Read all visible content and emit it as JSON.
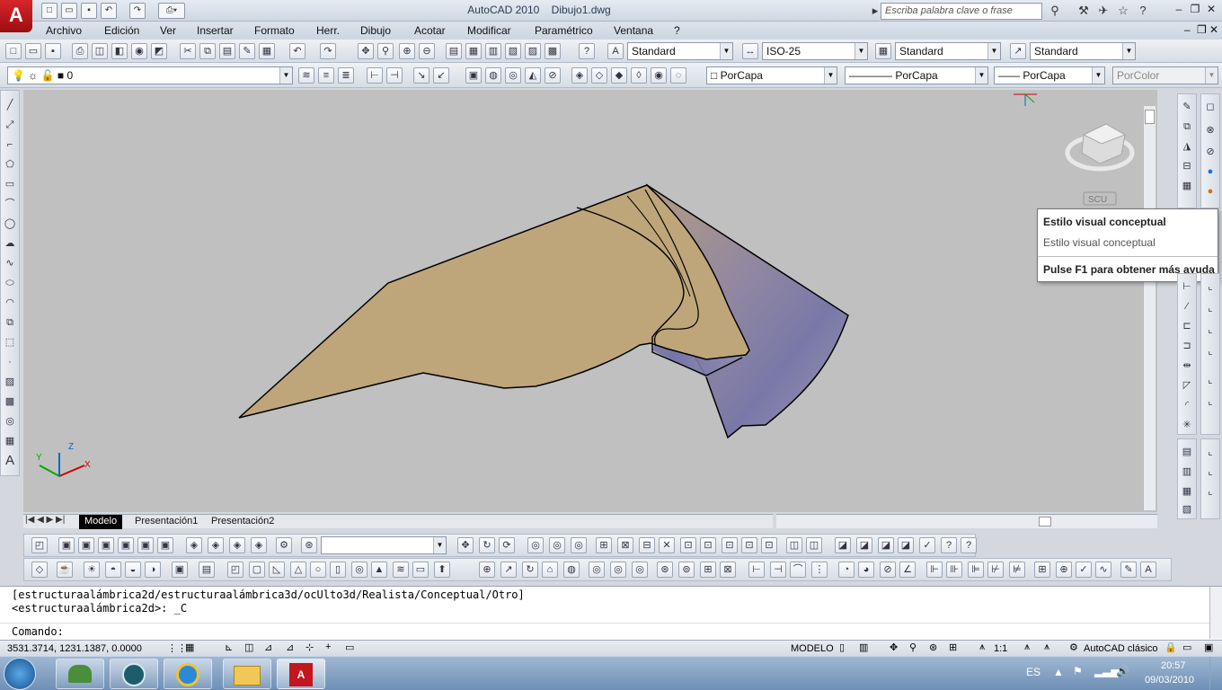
{
  "app": {
    "logo": "A",
    "title": "AutoCAD 2010",
    "document": "Dibujo1.dwg"
  },
  "search": {
    "placeholder": "Escriba palabra clave o frase"
  },
  "menu": [
    "Archivo",
    "Edición",
    "Ver",
    "Insertar",
    "Formato",
    "Herr.",
    "Dibujo",
    "Acotar",
    "Modificar",
    "Paramétrico",
    "Ventana",
    "?"
  ],
  "toolbar1": {
    "text_style": "Standard",
    "dim_style": "ISO-25",
    "table_style": "Standard",
    "mleader_style": "Standard"
  },
  "toolbar2": {
    "layer": "0",
    "color": "PorCapa",
    "linetype": "PorCapa",
    "lineweight": "PorCapa",
    "plotstyle": "PorColor"
  },
  "viewcube": {
    "ucs_label": "SCU"
  },
  "tooltip": {
    "title": "Estilo visual conceptual",
    "description": "Estilo visual conceptual",
    "help": "Pulse F1 para obtener más ayuda"
  },
  "tabs": [
    "Modelo",
    "Presentación1",
    "Presentación2"
  ],
  "ucs_axes": {
    "x": "X",
    "y": "Y",
    "z": "Z"
  },
  "command": {
    "history": [
      "[estructuraalámbrica2d/estructuraalámbrica3d/ocUlto3d/Realista/Conceptual/Otro]",
      "<estructuraalámbrica2d>: _C"
    ],
    "prompt": "Comando:"
  },
  "status": {
    "coords": "3531.3714, 1231.1387, 0.0000",
    "space": "MODELO",
    "scale": "1:1",
    "workspace": "AutoCAD clásico"
  },
  "taskbar": {
    "language": "ES",
    "time": "20:57",
    "date": "09/03/2010"
  },
  "colors": {
    "viewport_bg": "#c0c0c0",
    "solid_fill": "#bfa67a",
    "edge": "#000000",
    "shade": "#7a78a8",
    "accent": "#c4161c"
  }
}
